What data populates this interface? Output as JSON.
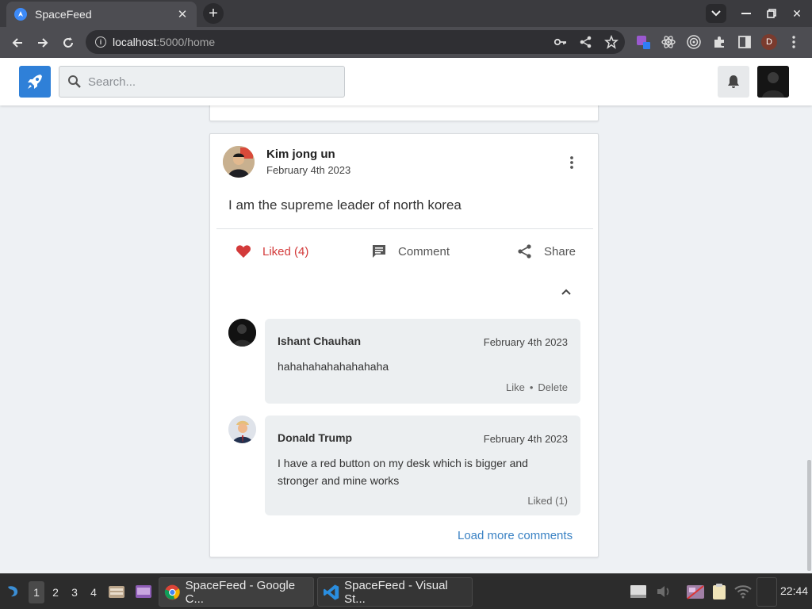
{
  "browser": {
    "tab_title": "SpaceFeed",
    "url_host": "localhost",
    "url_path": ":5000/home",
    "profile_initial": "D"
  },
  "header": {
    "search_placeholder": "Search...",
    "accent_color": "#2f80d8"
  },
  "post": {
    "author": "Kim jong un",
    "date": "February 4th 2023",
    "text": "I am the supreme leader of north korea",
    "like_label": "Liked (4)",
    "comment_label": "Comment",
    "share_label": "Share"
  },
  "comments": [
    {
      "author": "Ishant Chauhan",
      "date": "February 4th 2023",
      "text": "hahahahahahahahaha",
      "actions": [
        "Like",
        "Delete"
      ]
    },
    {
      "author": "Donald Trump",
      "date": "February 4th 2023",
      "text": "I have a red button on my desk which is bigger and stronger and mine works",
      "actions": [
        "Liked (1)"
      ]
    }
  ],
  "load_more_label": "Load more comments",
  "taskbar": {
    "workspaces": [
      "1",
      "2",
      "3",
      "4"
    ],
    "tasks": [
      "SpaceFeed - Google C...",
      "SpaceFeed - Visual St..."
    ],
    "clock": "22:44"
  }
}
